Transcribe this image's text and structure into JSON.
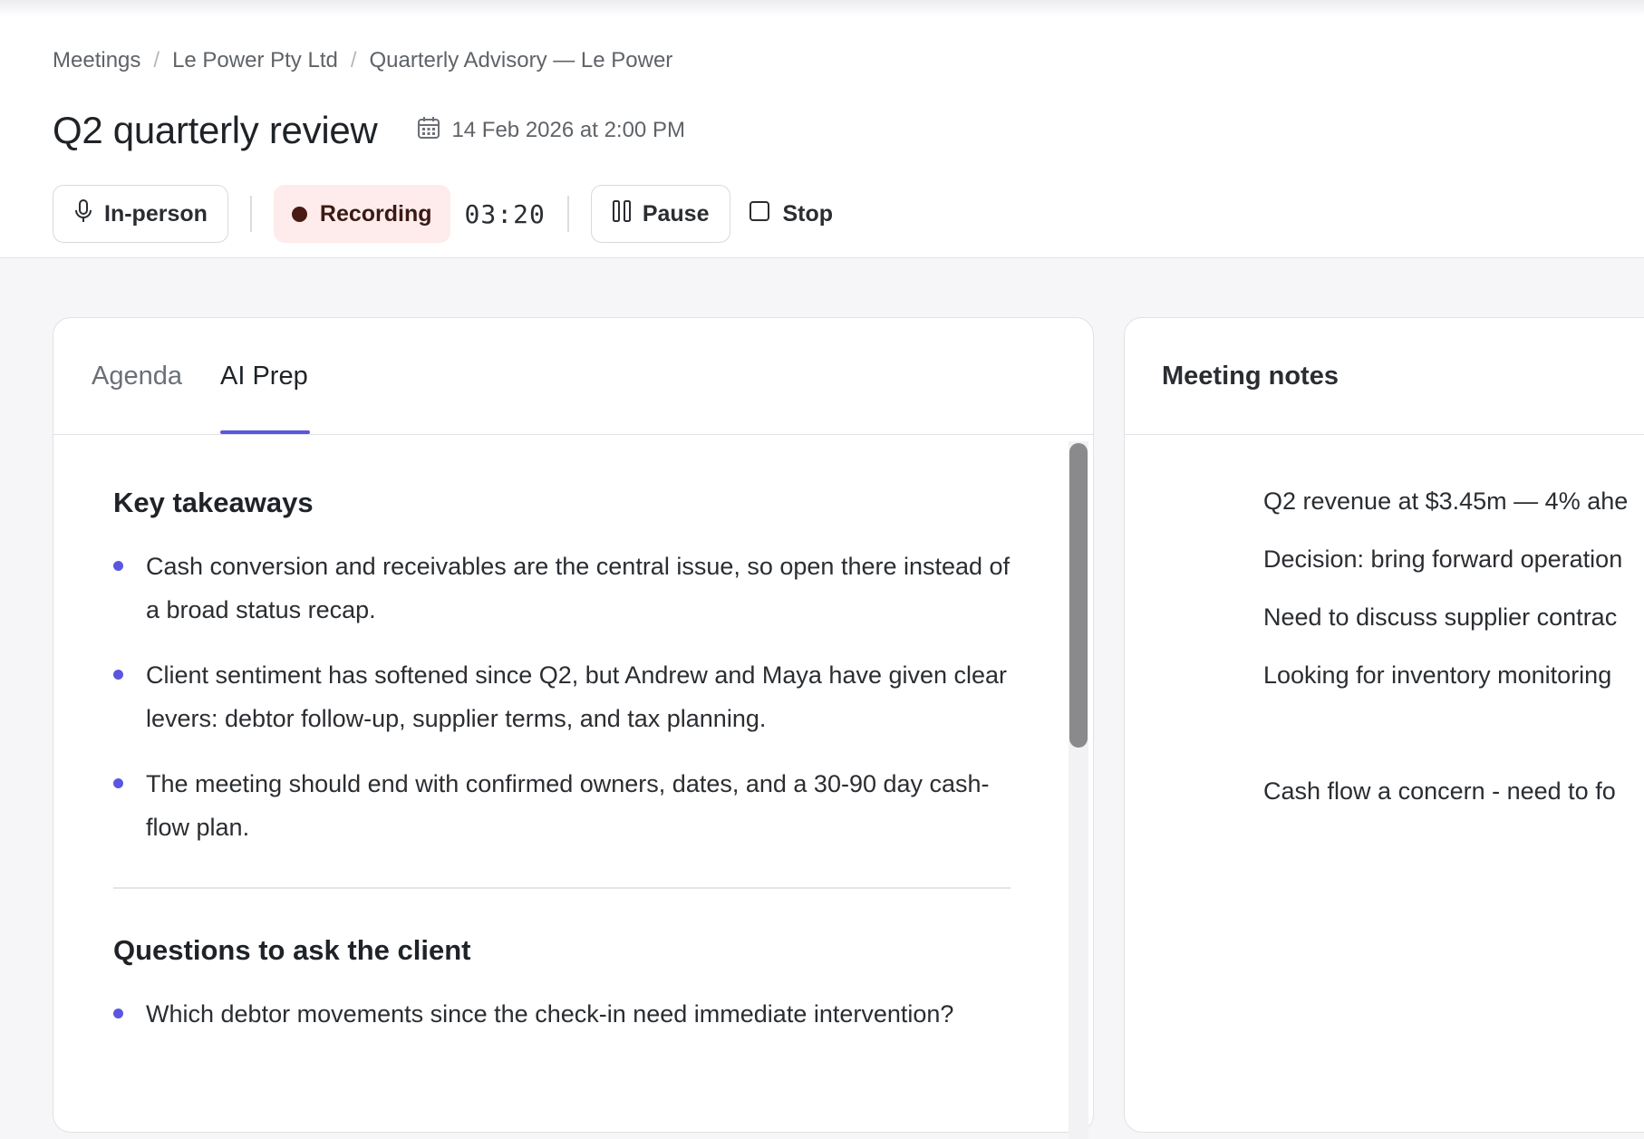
{
  "breadcrumb": {
    "items": [
      "Meetings",
      "Le Power Pty Ltd",
      "Quarterly Advisory — Le Power"
    ],
    "separator": "/"
  },
  "meeting": {
    "title": "Q2 quarterly review",
    "datetime": "14 Feb 2026 at 2:00 PM"
  },
  "controls": {
    "mode_label": "In-person",
    "recording_label": "Recording",
    "timer": "03:20",
    "pause_label": "Pause",
    "stop_label": "Stop"
  },
  "left_panel": {
    "tabs": [
      "Agenda",
      "AI Prep"
    ],
    "active_tab": "AI Prep",
    "key_takeaways": {
      "title": "Key takeaways",
      "bullets": [
        "Cash conversion and receivables are the central issue, so open there instead of a broad status recap.",
        "Client sentiment has softened since Q2, but Andrew and Maya have given clear levers: debtor follow-up, supplier terms, and tax planning.",
        "The meeting should end with confirmed owners, dates, and a 30-90 day cash-flow plan."
      ]
    },
    "questions": {
      "title": "Questions to ask the client",
      "bullets": [
        "Which debtor movements since the check-in need immediate intervention?"
      ]
    }
  },
  "right_panel": {
    "title": "Meeting notes",
    "notes": [
      "Q2 revenue at $3.45m — 4% ahe",
      "Decision: bring forward operation",
      "Need to discuss supplier contrac",
      "Looking for inventory monitoring",
      "Cash flow a concern - need to fo"
    ]
  },
  "colors": {
    "accent": "#5b56e0",
    "recording_bg": "#fdeceb",
    "recording_dot": "#4a1b15"
  },
  "icons": [
    "microphone-icon",
    "calendar-icon",
    "record-dot-icon",
    "pause-icon",
    "stop-icon"
  ]
}
